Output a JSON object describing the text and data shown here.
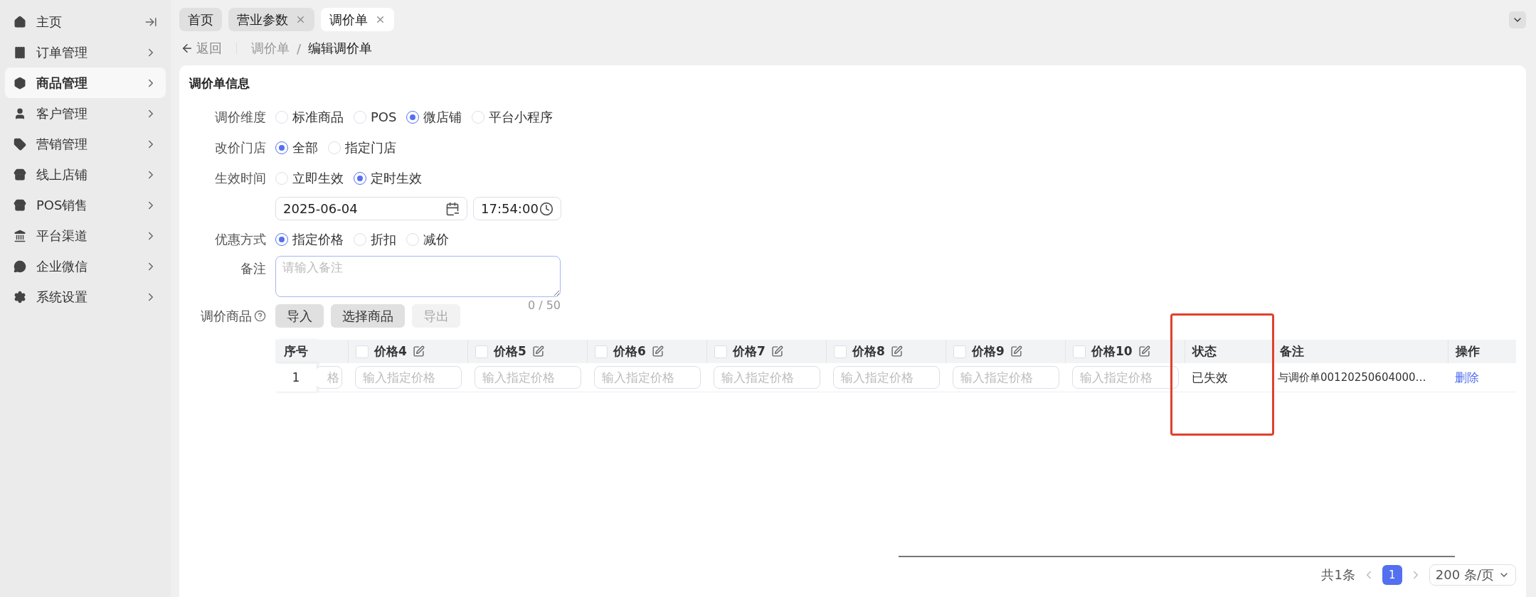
{
  "sidebar": {
    "items": [
      {
        "label": "主页",
        "kind": "collapse",
        "selected": false
      },
      {
        "label": "订单管理",
        "kind": "group",
        "selected": false
      },
      {
        "label": "商品管理",
        "kind": "group",
        "selected": true
      },
      {
        "label": "客户管理",
        "kind": "group",
        "selected": false
      },
      {
        "label": "营销管理",
        "kind": "group",
        "selected": false
      },
      {
        "label": "线上店铺",
        "kind": "group",
        "selected": false
      },
      {
        "label": "POS销售",
        "kind": "group",
        "selected": false
      },
      {
        "label": "平台渠道",
        "kind": "group",
        "selected": false
      },
      {
        "label": "企业微信",
        "kind": "group",
        "selected": false
      },
      {
        "label": "系统设置",
        "kind": "group",
        "selected": false
      }
    ]
  },
  "tabs": [
    {
      "label": "首页",
      "closable": false,
      "selected": false
    },
    {
      "label": "营业参数",
      "closable": true,
      "selected": false
    },
    {
      "label": "调价单",
      "closable": true,
      "selected": true
    }
  ],
  "breadcrumb": {
    "back": "返回",
    "separator": "/",
    "items": [
      {
        "label": "调价单",
        "current": false
      },
      {
        "label": "编辑调价单",
        "current": true
      }
    ]
  },
  "form": {
    "title": "调价单信息",
    "rows": [
      {
        "kind": "radio",
        "label": "调价维度",
        "options": [
          {
            "label": "标准商品",
            "selected": false
          },
          {
            "label": "POS",
            "selected": false
          },
          {
            "label": "微店铺",
            "selected": true
          },
          {
            "label": "平台小程序",
            "selected": false
          }
        ]
      },
      {
        "kind": "radio",
        "label": "改价门店",
        "options": [
          {
            "label": "全部",
            "selected": true
          },
          {
            "label": "指定门店",
            "selected": false
          }
        ]
      },
      {
        "kind": "radio",
        "label": "生效时间",
        "options": [
          {
            "label": "立即生效",
            "selected": false
          },
          {
            "label": "定时生效",
            "selected": true
          }
        ]
      },
      {
        "kind": "datetime",
        "date": "2025-06-04",
        "time": "17:54:00"
      },
      {
        "kind": "radio",
        "label": "优惠方式",
        "options": [
          {
            "label": "指定价格",
            "selected": true
          },
          {
            "label": "折扣",
            "selected": false
          },
          {
            "label": "减价",
            "selected": false
          }
        ]
      },
      {
        "kind": "textarea",
        "label": "备注",
        "placeholder": "请输入备注",
        "counter": "0 / 50"
      },
      {
        "kind": "buttons",
        "label": "调价商品",
        "buttons": [
          {
            "label": "导入",
            "disabled": false
          },
          {
            "label": "选择商品",
            "disabled": false
          },
          {
            "label": "导出",
            "disabled": true
          }
        ]
      }
    ]
  },
  "table": {
    "columns": [
      {
        "kind": "index",
        "label": "序号"
      },
      {
        "kind": "blank"
      },
      {
        "kind": "price",
        "label": "价格4",
        "checked": false
      },
      {
        "kind": "price",
        "label": "价格5",
        "checked": false
      },
      {
        "kind": "price",
        "label": "价格6",
        "checked": false
      },
      {
        "kind": "price",
        "label": "价格7",
        "checked": false
      },
      {
        "kind": "price",
        "label": "价格8",
        "checked": false
      },
      {
        "kind": "price",
        "label": "价格9",
        "checked": false
      },
      {
        "kind": "price",
        "label": "价格10",
        "checked": false
      },
      {
        "kind": "status",
        "label": "状态"
      },
      {
        "kind": "note",
        "label": "备注"
      },
      {
        "kind": "action",
        "label": "操作"
      }
    ],
    "rows": [
      {
        "cells": [
          {
            "kind": "text",
            "text": "1"
          },
          {
            "kind": "input",
            "placeholder": "格"
          },
          {
            "kind": "input",
            "placeholder": "输入指定价格"
          },
          {
            "kind": "input",
            "placeholder": "输入指定价格"
          },
          {
            "kind": "input",
            "placeholder": "输入指定价格"
          },
          {
            "kind": "input",
            "placeholder": "输入指定价格"
          },
          {
            "kind": "input",
            "placeholder": "输入指定价格"
          },
          {
            "kind": "input",
            "placeholder": "输入指定价格"
          },
          {
            "kind": "input",
            "placeholder": "输入指定价格"
          },
          {
            "kind": "text",
            "text": "已失效"
          },
          {
            "kind": "text",
            "text": "与调价单00120250604000…"
          },
          {
            "kind": "link",
            "text": "删除"
          }
        ]
      }
    ]
  },
  "pagination": {
    "total": "共1条",
    "pages": [
      {
        "label": "1",
        "selected": true
      }
    ],
    "page_size": "200 条/页"
  }
}
